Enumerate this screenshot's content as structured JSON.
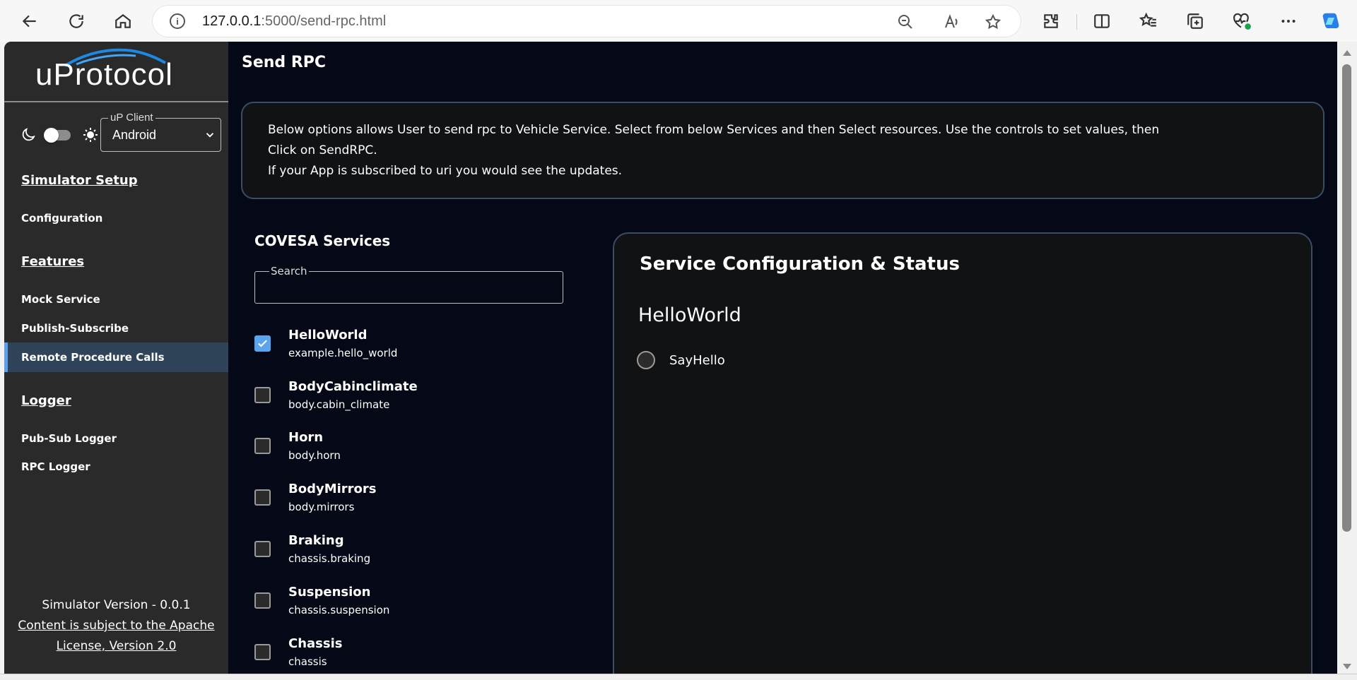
{
  "browser": {
    "url_host": "127.0.0.1",
    "url_path": ":5000/send-rpc.html"
  },
  "sidebar": {
    "logo_text": "uProtocol",
    "client_select": {
      "legend": "uP Client",
      "value": "Android"
    },
    "sections": {
      "simulator_setup": "Simulator Setup",
      "features": "Features",
      "logger": "Logger"
    },
    "links": {
      "configuration": "Configuration",
      "mock_service": "Mock Service",
      "publish_subscribe": "Publish-Subscribe",
      "remote_procedure_calls": "Remote Procedure Calls",
      "pub_sub_logger": "Pub-Sub Logger",
      "rpc_logger": "RPC Logger"
    },
    "footer": {
      "version": "Simulator Version - 0.0.1",
      "license": "Content is subject to the Apache License, Version 2.0"
    }
  },
  "main": {
    "title": "Send RPC",
    "info": {
      "line1": "Below options allows User to send rpc to Vehicle Service. Select from below Services and then Select resources. Use the controls to set values, then",
      "line2": "Click on SendRPC.",
      "line3": "If your App is subscribed to uri you would see the updates."
    },
    "services_title": "COVESA Services",
    "search_legend": "Search",
    "services": [
      {
        "name": "HelloWorld",
        "uri": "example.hello_world",
        "checked": true
      },
      {
        "name": "BodyCabinclimate",
        "uri": "body.cabin_climate",
        "checked": false
      },
      {
        "name": "Horn",
        "uri": "body.horn",
        "checked": false
      },
      {
        "name": "BodyMirrors",
        "uri": "body.mirrors",
        "checked": false
      },
      {
        "name": "Braking",
        "uri": "chassis.braking",
        "checked": false
      },
      {
        "name": "Suspension",
        "uri": "chassis.suspension",
        "checked": false
      },
      {
        "name": "Chassis",
        "uri": "chassis",
        "checked": false
      }
    ],
    "config": {
      "title": "Service Configuration & Status",
      "service_name": "HelloWorld",
      "methods": [
        {
          "label": "SayHello",
          "selected": false
        }
      ]
    }
  },
  "colors": {
    "page_background": "#050816",
    "sidebar_background": "#2a2a2a",
    "active_link_background": "#2f4359",
    "accent": "#5aa5ee",
    "panel_border": "#3a4d63"
  }
}
